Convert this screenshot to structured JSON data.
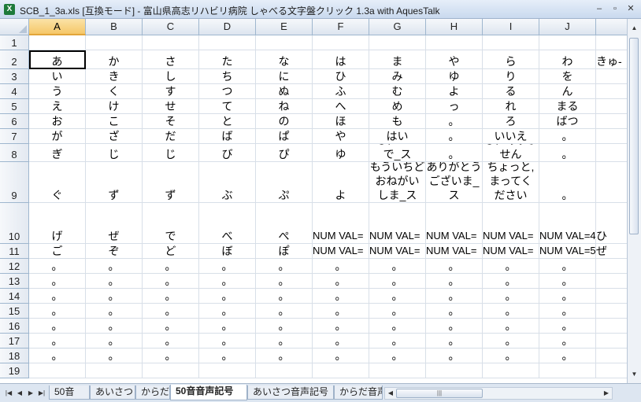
{
  "window": {
    "title": "SCB_1_3a.xls  [互換モード] - 富山県高志リハビリ病院  しゃべる文字盤クリック  1.3a  with AquesTalk",
    "app_icon": "X",
    "controls": [
      "–",
      "▫",
      "✕"
    ]
  },
  "columns": [
    "A",
    "B",
    "C",
    "D",
    "E",
    "F",
    "G",
    "H",
    "I",
    "J"
  ],
  "selected_column": "A",
  "selected_cell": "A2",
  "rows": [
    {
      "num": "1",
      "cells": [
        "",
        "",
        "",
        "",
        "",
        "",
        "",
        "",
        "",
        ""
      ]
    },
    {
      "num": "2",
      "cells": [
        "あ",
        "か",
        "さ",
        "た",
        "な",
        "は",
        "ま",
        "や",
        "ら",
        "わ"
      ]
    },
    {
      "num": "3",
      "cells": [
        "い",
        "き",
        "し",
        "ち",
        "に",
        "ひ",
        "み",
        "ゆ",
        "り",
        "を"
      ]
    },
    {
      "num": "4",
      "cells": [
        "う",
        "く",
        "す",
        "つ",
        "ぬ",
        "ふ",
        "む",
        "よ",
        "る",
        "ん"
      ]
    },
    {
      "num": "5",
      "cells": [
        "え",
        "け",
        "せ",
        "て",
        "ね",
        "へ",
        "め",
        "っ",
        "れ",
        "まる"
      ]
    },
    {
      "num": "6",
      "cells": [
        "お",
        "こ",
        "そ",
        "と",
        "の",
        "ほ",
        "も",
        "。",
        "ろ",
        "ばつ"
      ]
    },
    {
      "num": "7",
      "cells": [
        "が",
        "ざ",
        "だ",
        "ば",
        "ぱ",
        "や",
        "はい",
        "。",
        "いいえ",
        "。"
      ]
    },
    {
      "num": "8",
      "cells": [
        "ぎ",
        "じ",
        "じ",
        "び",
        "ぴ",
        "ゆ",
        "どちらで\nも、いい\nで_ス",
        "。",
        "どちらで\nも、ありま\nせん",
        "。"
      ]
    },
    {
      "num": "9",
      "cells": [
        "ぐ",
        "ず",
        "ず",
        "ぶ",
        "ぷ",
        "よ",
        "もういちど\nおねがい\nしま_ス",
        "ありがとう\nございま_\nス",
        "ちょっと,\nまってく\nださい",
        "。"
      ]
    },
    {
      "num": "10",
      "cells": [
        "げ",
        "ぜ",
        "で",
        "べ",
        "ぺ",
        "NUM VAL=",
        "NUM VAL=",
        "NUM VAL=",
        "NUM VAL=",
        "NUM VAL=4"
      ]
    },
    {
      "num": "11",
      "cells": [
        "ご",
        "ぞ",
        "ど",
        "ぼ",
        "ぽ",
        "NUM VAL=",
        "NUM VAL=",
        "NUM VAL=",
        "NUM VAL=",
        "NUM VAL=5"
      ]
    },
    {
      "num": "12",
      "cells": [
        "。",
        "。",
        "。",
        "。",
        "。",
        "。",
        "。",
        "。",
        "。",
        "。"
      ]
    },
    {
      "num": "13",
      "cells": [
        "。",
        "。",
        "。",
        "。",
        "。",
        "。",
        "。",
        "。",
        "。",
        "。"
      ]
    },
    {
      "num": "14",
      "cells": [
        "。",
        "。",
        "。",
        "。",
        "。",
        "。",
        "。",
        "。",
        "。",
        "。"
      ]
    },
    {
      "num": "15",
      "cells": [
        "。",
        "。",
        "。",
        "。",
        "。",
        "。",
        "。",
        "。",
        "。",
        "。"
      ]
    },
    {
      "num": "16",
      "cells": [
        "。",
        "。",
        "。",
        "。",
        "。",
        "。",
        "。",
        "。",
        "。",
        "。"
      ]
    },
    {
      "num": "17",
      "cells": [
        "。",
        "。",
        "。",
        "。",
        "。",
        "。",
        "。",
        "。",
        "。",
        "。"
      ]
    },
    {
      "num": "18",
      "cells": [
        "。",
        "。",
        "。",
        "。",
        "。",
        "。",
        "。",
        "。",
        "。",
        "。"
      ]
    },
    {
      "num": "19",
      "cells": [
        "",
        "",
        "",
        "",
        "",
        "",
        "",
        "",
        "",
        ""
      ]
    }
  ],
  "overflow_right": {
    "row2": "きゅ-",
    "row10": "ひ",
    "row11": "ぜ"
  },
  "sheet_tabs": [
    "50音",
    "あいさつ",
    "からだ",
    "50音音声記号",
    "あいさつ音声記号",
    "からだ音声"
  ],
  "active_tab": "50音音声記号",
  "nav_buttons": [
    "|◀",
    "◀",
    "▶",
    "▶|"
  ]
}
